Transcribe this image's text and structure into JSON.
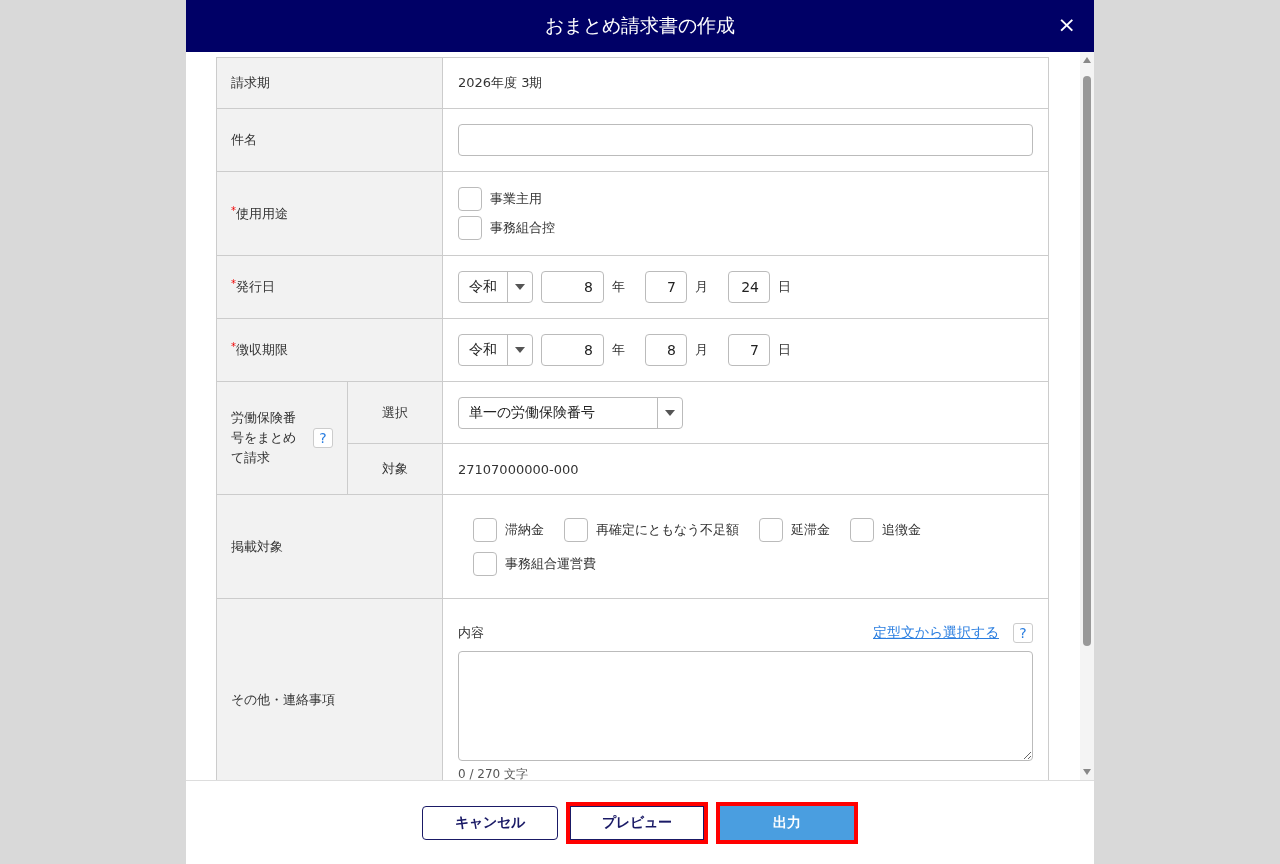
{
  "dialog": {
    "title": "おまとめ請求書の作成",
    "close": "×"
  },
  "rows": [
    {
      "kind": "text",
      "label": "請求期",
      "value": "2026年度 3期"
    },
    {
      "kind": "input",
      "label": "件名"
    },
    {
      "kind": "stack",
      "label": "使用用途",
      "mark": "*",
      "options": [
        {
          "label": "事業主用",
          "checked": false
        },
        {
          "label": "事務組合控",
          "checked": false
        }
      ]
    },
    {
      "kind": "date",
      "label": "発行日",
      "mark": "*",
      "era": "令和",
      "year": "8",
      "year_unit": "年",
      "month": "7",
      "month_unit": "月",
      "day": "24",
      "day_unit": "日"
    },
    {
      "kind": "date",
      "label": "徴収期限",
      "mark": "*",
      "era": "令和",
      "year": "8",
      "year_unit": "年",
      "month": "8",
      "month_unit": "月",
      "day": "7",
      "day_unit": "日"
    },
    {
      "kind": "group",
      "label": "労働保険番号をまとめて請求",
      "help": "?",
      "subrows": [
        {
          "kind": "select",
          "label": "選択",
          "value": "単一の労働保険番号"
        },
        {
          "kind": "text",
          "label": "対象",
          "value": "27107000000-000"
        }
      ]
    },
    {
      "kind": "wrap",
      "label": "掲載対象",
      "options": [
        {
          "label": "滞納金",
          "checked": false
        },
        {
          "label": "再確定にともなう不足額",
          "checked": false
        },
        {
          "label": "延滞金",
          "checked": false
        },
        {
          "label": "追徴金",
          "checked": false
        },
        {
          "label": "事務組合運営費",
          "checked": false
        }
      ]
    },
    {
      "kind": "notes",
      "label": "その他・連絡事項",
      "field_label": "内容",
      "link": "定型文から選択する",
      "help": "?",
      "counter": "0 / 270 文字"
    }
  ],
  "buttons": [
    {
      "kind": "outline",
      "label": "キャンセル",
      "highlighted": false
    },
    {
      "kind": "outline",
      "label": "プレビュー",
      "highlighted": true
    },
    {
      "kind": "primary",
      "label": "出力",
      "highlighted": true
    }
  ]
}
